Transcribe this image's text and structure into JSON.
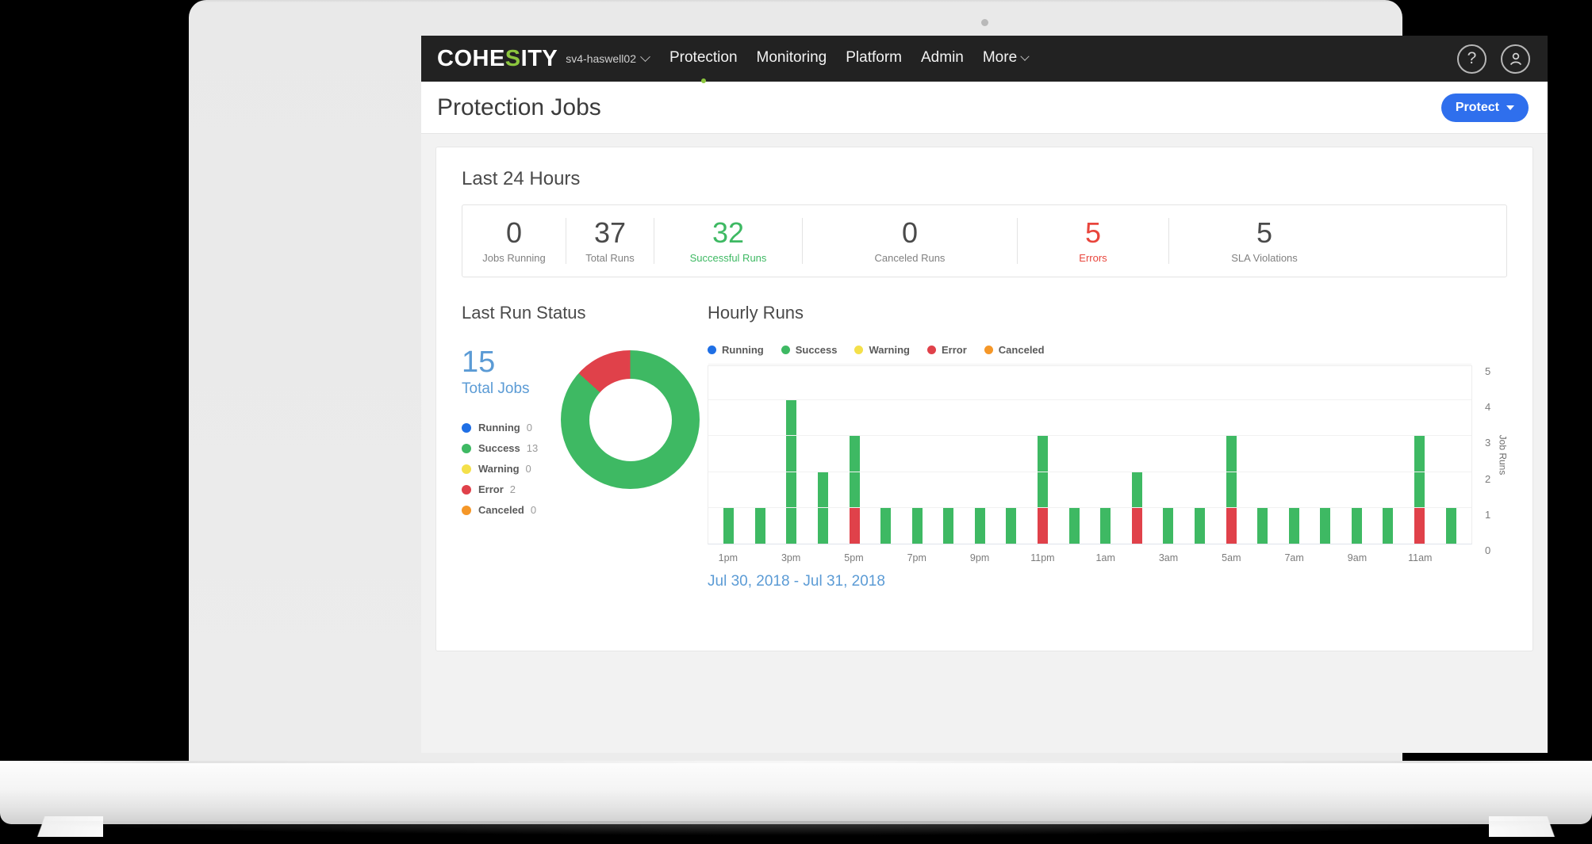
{
  "topnav": {
    "brand_pre": "COHE",
    "brand_accent": "S",
    "brand_post": "ITY",
    "cluster": "sv4-haswell02",
    "items": [
      {
        "label": "Protection",
        "active": true
      },
      {
        "label": "Monitoring",
        "active": false
      },
      {
        "label": "Platform",
        "active": false
      },
      {
        "label": "Admin",
        "active": false
      },
      {
        "label": "More",
        "active": false
      }
    ],
    "help_icon": "question-mark-icon",
    "account_icon": "user-avatar-icon"
  },
  "header": {
    "title": "Protection Jobs",
    "protect_label": "Protect"
  },
  "last24": {
    "title": "Last 24 Hours",
    "stats": [
      {
        "value": "0",
        "label": "Jobs Running",
        "tone": "default"
      },
      {
        "value": "37",
        "label": "Total Runs",
        "tone": "default"
      },
      {
        "value": "32",
        "label": "Successful Runs",
        "tone": "success"
      },
      {
        "value": "0",
        "label": "Canceled Runs",
        "tone": "default"
      },
      {
        "value": "5",
        "label": "Errors",
        "tone": "error"
      },
      {
        "value": "5",
        "label": "SLA Violations",
        "tone": "default"
      }
    ]
  },
  "last_run_status": {
    "title": "Last Run Status",
    "total_value": "15",
    "total_label": "Total Jobs",
    "legend": [
      {
        "name": "Running",
        "value": "0",
        "color": "#1f6fe5"
      },
      {
        "name": "Success",
        "value": "13",
        "color": "#3eb963"
      },
      {
        "name": "Warning",
        "value": "0",
        "color": "#f4e04a"
      },
      {
        "name": "Error",
        "value": "2",
        "color": "#e0414a"
      },
      {
        "name": "Canceled",
        "value": "0",
        "color": "#f59728"
      }
    ]
  },
  "hourly_runs": {
    "title": "Hourly Runs",
    "legend": [
      {
        "name": "Running",
        "color": "#1f6fe5"
      },
      {
        "name": "Success",
        "color": "#3eb963"
      },
      {
        "name": "Warning",
        "color": "#f4e04a"
      },
      {
        "name": "Error",
        "color": "#e0414a"
      },
      {
        "name": "Canceled",
        "color": "#f59728"
      }
    ],
    "date_range": "Jul 30, 2018 - Jul 31, 2018"
  },
  "chart_data": [
    {
      "type": "pie",
      "title": "Last Run Status",
      "subtitle": "15 Total Jobs",
      "labels": [
        "Running",
        "Success",
        "Warning",
        "Error",
        "Canceled"
      ],
      "values": [
        0,
        13,
        0,
        2,
        0
      ],
      "colors": [
        "#1f6fe5",
        "#3eb963",
        "#f4e04a",
        "#e0414a",
        "#f59728"
      ],
      "donut": true,
      "total": 15,
      "legend_position": "left",
      "start_angle_deg": 0,
      "direction": "clockwise"
    },
    {
      "type": "bar",
      "title": "Hourly Runs",
      "stacked": true,
      "xlabel": "",
      "ylabel": "Job Runs",
      "ylim": [
        0,
        5
      ],
      "yticks": [
        0,
        1,
        2,
        3,
        4,
        5
      ],
      "grid": true,
      "legend_position": "top",
      "annotation": "Jul 30, 2018 - Jul 31, 2018",
      "categories": [
        "1pm",
        "2pm",
        "3pm",
        "4pm",
        "5pm",
        "6pm",
        "7pm",
        "8pm",
        "9pm",
        "10pm",
        "11pm",
        "12am",
        "1am",
        "2am",
        "3am",
        "4am",
        "5am",
        "6am",
        "7am",
        "8am",
        "9am",
        "10am",
        "11am",
        "12pm"
      ],
      "xtick_labels": [
        "1pm",
        "",
        "3pm",
        "",
        "5pm",
        "",
        "7pm",
        "",
        "9pm",
        "",
        "11pm",
        "",
        "1am",
        "",
        "3am",
        "",
        "5am",
        "",
        "7am",
        "",
        "9am",
        "",
        "11am",
        ""
      ],
      "series": [
        {
          "name": "Error",
          "color": "#e0414a",
          "values": [
            0,
            0,
            0,
            0,
            1,
            0,
            0,
            0,
            0,
            0,
            1,
            0,
            0,
            1,
            0,
            0,
            1,
            0,
            0,
            0,
            0,
            0,
            1,
            0
          ]
        },
        {
          "name": "Success",
          "color": "#3eb963",
          "values": [
            1,
            1,
            4,
            2,
            2,
            1,
            1,
            1,
            1,
            1,
            2,
            1,
            1,
            1,
            1,
            1,
            2,
            1,
            1,
            1,
            1,
            1,
            2,
            1
          ]
        }
      ],
      "totals": [
        1,
        1,
        4,
        2,
        3,
        1,
        1,
        1,
        1,
        1,
        3,
        1,
        1,
        2,
        1,
        1,
        3,
        1,
        1,
        1,
        1,
        1,
        3,
        1
      ]
    }
  ]
}
